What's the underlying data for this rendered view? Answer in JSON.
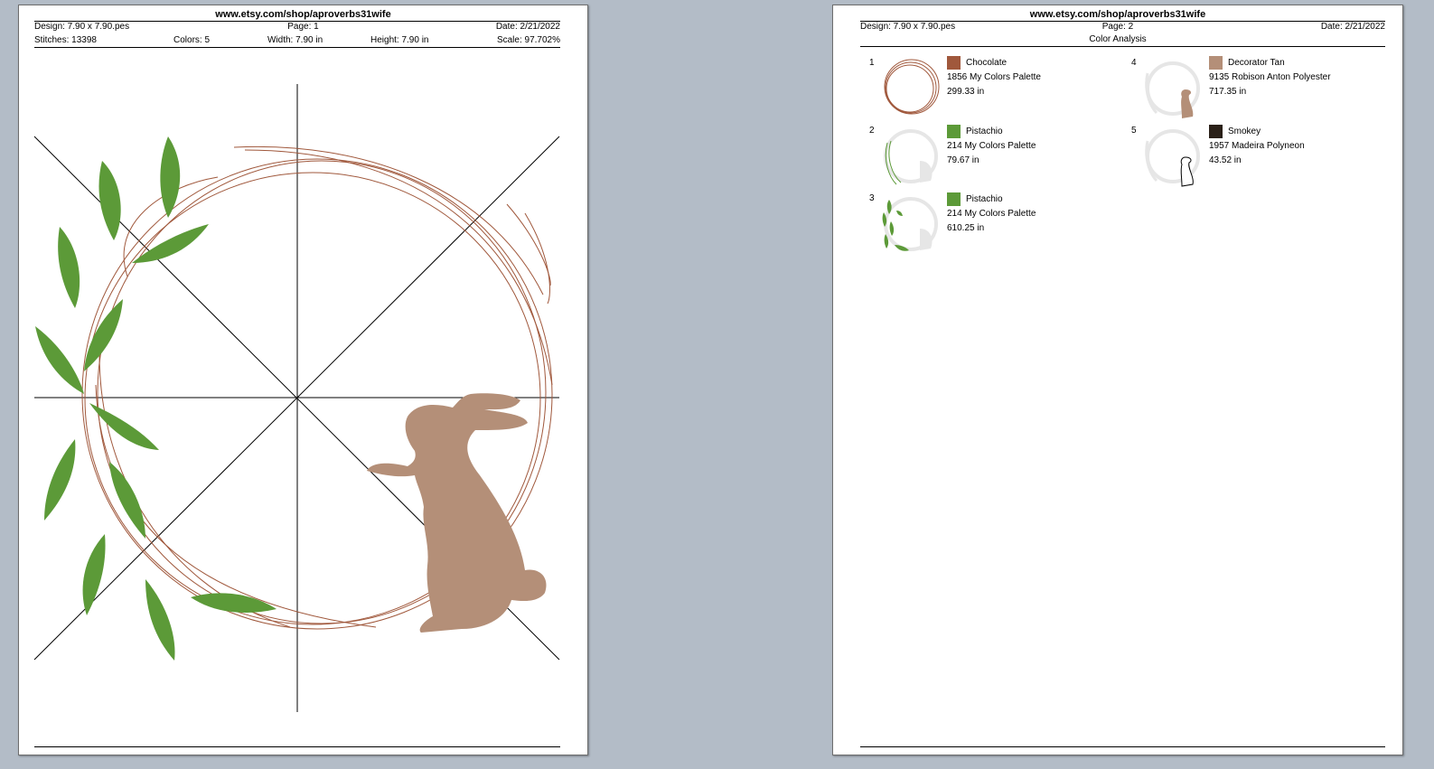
{
  "page1": {
    "site": "www.etsy.com/shop/aproverbs31wife",
    "design": "Design: 7.90 x 7.90.pes",
    "page": "Page: 1",
    "date": "Date: 2/21/2022",
    "stitches": "Stitches: 13398",
    "colors": "Colors: 5",
    "width": "Width: 7.90 in",
    "height": "Height: 7.90 in",
    "scale": "Scale: 97.702%"
  },
  "page2": {
    "site": "www.etsy.com/shop/aproverbs31wife",
    "design": "Design: 7.90 x 7.90.pes",
    "page": "Page: 2",
    "date": "Date: 2/21/2022",
    "section_title": "Color Analysis",
    "colors": [
      {
        "index": "1",
        "name": "Chocolate",
        "code": "1856 My Colors Palette",
        "length": "299.33 in",
        "swatch": "#a0583c"
      },
      {
        "index": "2",
        "name": "Pistachio",
        "code": "214 My Colors Palette",
        "length": "79.67 in",
        "swatch": "#5c9a38"
      },
      {
        "index": "3",
        "name": "Pistachio",
        "code": "214 My Colors Palette",
        "length": "610.25 in",
        "swatch": "#5c9a38"
      },
      {
        "index": "4",
        "name": "Decorator Tan",
        "code": "9135 Robison Anton Polyester",
        "length": "717.35 in",
        "swatch": "#b48f78"
      },
      {
        "index": "5",
        "name": "Smokey",
        "code": "1957 Madeira Polyneon",
        "length": "43.52 in",
        "swatch": "#2a2018"
      }
    ]
  },
  "palette": {
    "background": "#b3bcc7",
    "twig": "#a0583c",
    "leaf": "#5c9a38",
    "bunny": "#b48f78"
  }
}
